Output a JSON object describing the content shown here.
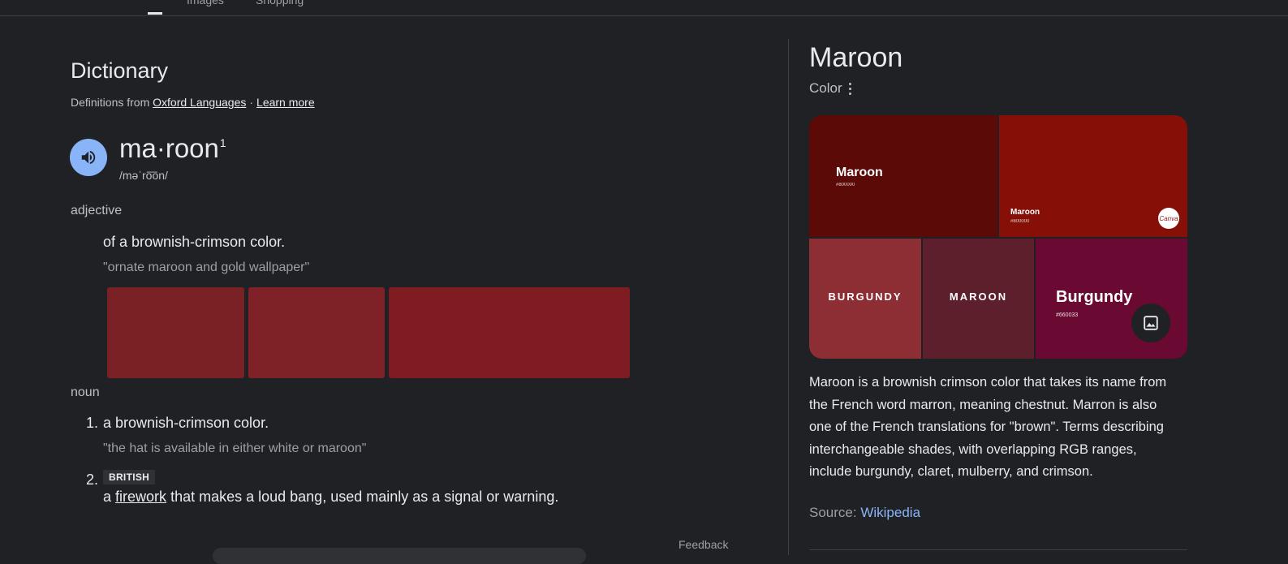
{
  "topbar": {
    "tab_a": "Images",
    "tab_b": "Shopping"
  },
  "dictionary": {
    "title": "Dictionary",
    "source_prefix": "Definitions from",
    "source_link": "Oxford Languages",
    "separator": "·",
    "learn_more": "Learn more",
    "headword": "ma·roon",
    "superscript": "1",
    "phonetic": "/məˈro͞on/",
    "adjective": {
      "pos": "adjective",
      "definition": "of a brownish-crimson color.",
      "example": "\"ornate maroon and gold wallpaper\""
    },
    "swatch_colors": [
      "#7a2126",
      "#7e2227",
      "#7f1c22"
    ],
    "noun": {
      "pos": "noun",
      "senses": [
        {
          "number": "1.",
          "definition": "a brownish-crimson color.",
          "example": "\"the hat is available in either white or maroon\""
        },
        {
          "number": "2.",
          "label": "BRITISH",
          "definition_prefix": "a",
          "definition_link": "firework",
          "definition_suffix": "that makes a loud bang, used mainly as a signal or warning."
        }
      ]
    },
    "feedback": "Feedback"
  },
  "panel": {
    "title": "Maroon",
    "subtitle": "Color",
    "collage": {
      "tile1": {
        "title": "Maroon",
        "hex": "#800000",
        "color": "#5c0a07"
      },
      "tile2": {
        "title": "Maroon",
        "hex": "#800000",
        "color": "#860f07",
        "badge": "Canva"
      },
      "tile3": {
        "title": "BURGUNDY",
        "color": "#8d2e35"
      },
      "tile4": {
        "title": "MAROON",
        "color": "#5e1f2c"
      },
      "tile5": {
        "title": "Burgundy",
        "hex": "#660033",
        "color": "#6a0a32"
      }
    },
    "description": "Maroon is a brownish crimson color that takes its name from the French word marron, meaning chestnut. Marron is also one of the French translations for \"brown\". Terms describing interchangeable shades, with overlapping RGB ranges, include burgundy, claret, mulberry, and crimson.",
    "source_prefix": "Source:",
    "source_link": "Wikipedia"
  },
  "colors": {
    "background": "#202124",
    "accent": "#8ab4f8"
  }
}
